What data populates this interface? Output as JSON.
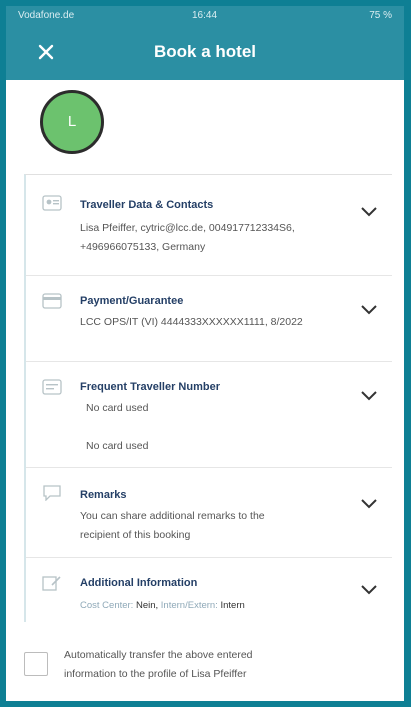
{
  "status_bar": {
    "carrier": "Vodafone.de",
    "time": "16:44",
    "battery": "75 %"
  },
  "app_bar": {
    "close_icon": "close-icon",
    "title": "Book a hotel"
  },
  "avatar": {
    "initial": "L",
    "color": "#6cc26e"
  },
  "sections": [
    {
      "title": "Traveller Data & Contacts",
      "line1": "Lisa Pfeiffer, cytric@lcc.de, 004917712334S6,",
      "line2": "+496966075133, Germany",
      "icon": "contact-card-icon"
    },
    {
      "title": "Payment/Guarantee",
      "line1": "LCC OPS/IT (VI) 4444333XXXXXX1111, 8/2022",
      "icon": "credit-card-icon"
    },
    {
      "title": "Frequent Traveller Number",
      "line1": "No card used",
      "line2": "No card used",
      "icon": "loyalty-card-icon"
    },
    {
      "title": "Remarks",
      "line1": "You can share additional remarks to the",
      "line2": "recipient of this booking",
      "icon": "comment-icon"
    },
    {
      "title": "Additional Information",
      "line1_label": "Cost Center:",
      "line1_value": "Nein,",
      "line1_label2": "Intern/Extern:",
      "line1_value2": "Intern",
      "icon": "edit-document-icon"
    }
  ],
  "transfer": {
    "checked": false,
    "line1": "Automatically transfer the above entered",
    "line2": "information to the profile of Lisa Pfeiffer"
  },
  "colors": {
    "primary": "#2b8fa3",
    "title_text": "#243f66",
    "body_text": "#555555"
  }
}
